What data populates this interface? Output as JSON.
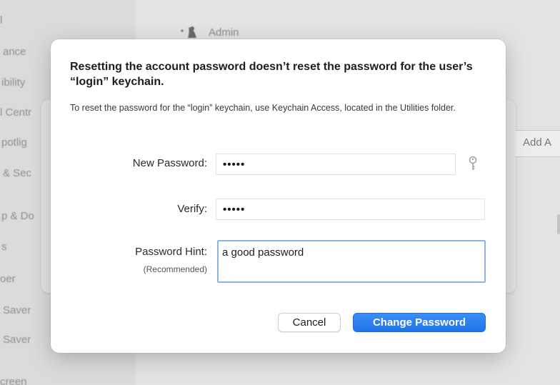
{
  "background": {
    "sidebar_items": [
      {
        "label": "l"
      },
      {
        "label": "ance"
      },
      {
        "label": "ibility"
      },
      {
        "label": "l Centr"
      },
      {
        "label": "potlig"
      },
      {
        "label": "& Sec"
      },
      {
        "label": "p & Do"
      },
      {
        "label": "s"
      },
      {
        "label": "oer"
      },
      {
        "label": "Saver"
      },
      {
        "label": "Saver"
      },
      {
        "label": "creen"
      }
    ],
    "user_label": "Admin",
    "add_field_label": "Add A"
  },
  "dialog": {
    "title": "Resetting the account password doesn’t reset the password for the user’s “login” keychain.",
    "message": "To reset the password for the “login” keychain, use Keychain Access, located in the Utilities folder.",
    "new_password": {
      "label": "New Password:",
      "value": "•••••",
      "assistant_icon": "key-icon"
    },
    "verify": {
      "label": "Verify:",
      "value": "•••••"
    },
    "hint": {
      "label": "Password Hint:",
      "sublabel": "(Recommended)",
      "value": "a good password"
    },
    "buttons": {
      "cancel": "Cancel",
      "primary": "Change Password"
    },
    "colors": {
      "accent": "#1f74ea",
      "focus_ring": "#8cb2e6"
    }
  }
}
